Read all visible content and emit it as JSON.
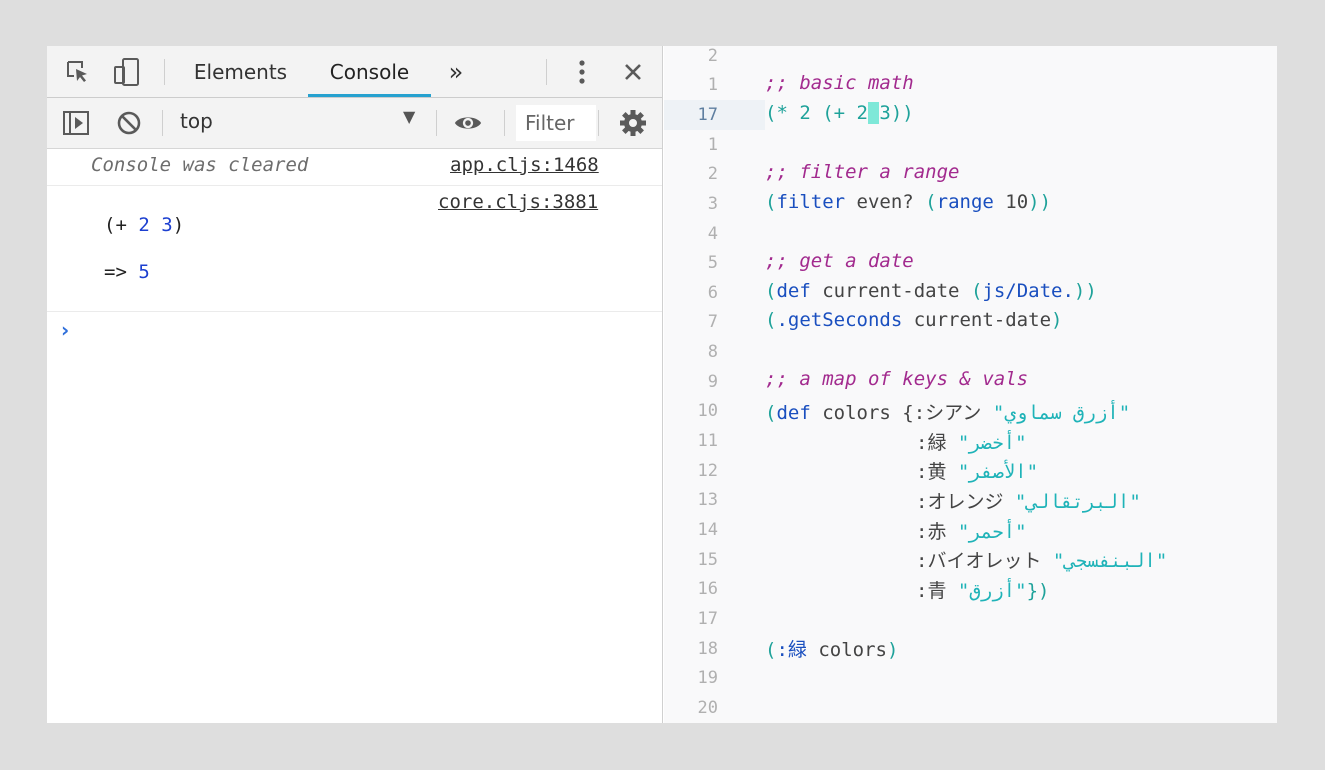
{
  "devtools": {
    "tabs": [
      "Elements",
      "Console"
    ],
    "more_tabs": "»",
    "toolbar": {
      "context": "top",
      "filter_placeholder": "Filter"
    },
    "console": {
      "cleared_text": "Console was cleared",
      "source1": "app.cljs:1468",
      "source2": "core.cljs:3881",
      "output_expr_open": "(+ ",
      "output_expr_n1": "2",
      "output_expr_n2": "3",
      "output_expr_close": ")",
      "result_arrow": "=> ",
      "result_value": "5",
      "prompt": "›"
    }
  },
  "editor": {
    "line_numbers": [
      "2",
      "1",
      "17",
      "1",
      "2",
      "3",
      "4",
      "5",
      "6",
      "7",
      "8",
      "9",
      "10",
      "11",
      "12",
      "13",
      "14",
      "15",
      "16",
      "17",
      "18",
      "19",
      "20"
    ],
    "comment1": ";; basic math",
    "code_math_a": "(* 2 (+ 2",
    "code_math_b": " ",
    "code_math_c": "3))",
    "comment2": ";; filter a range",
    "code_filter_fn": "filter",
    "code_filter_arg": " even? ",
    "code_range_fn": "range",
    "code_range_arg": " 10",
    "comment3": ";; get a date",
    "code_def": "def",
    "code_def_name": " current-date ",
    "code_jsdate": "js/Date.",
    "code_getseconds": ".getSeconds",
    "code_getseconds_arg": " current-date",
    "comment4": ";; a map of keys & vals",
    "code_colors_name": " colors {",
    "map_entries": [
      {
        "key": ":シアン",
        "value": "\"أزرق سماوي\""
      },
      {
        "key": ":緑",
        "value": "\"أخضر\""
      },
      {
        "key": ":黄",
        "value": "\"الأصفر\""
      },
      {
        "key": ":オレンジ",
        "value": "\"البرتقالي\""
      },
      {
        "key": ":赤",
        "value": "\"أحمر\""
      },
      {
        "key": ":バイオレット",
        "value": "\"البنفسجي\""
      },
      {
        "key": ":青",
        "value": "\"أزرق\""
      }
    ],
    "map_close": "})",
    "code_lookup_key": ":緑",
    "code_lookup_arg": " colors"
  }
}
